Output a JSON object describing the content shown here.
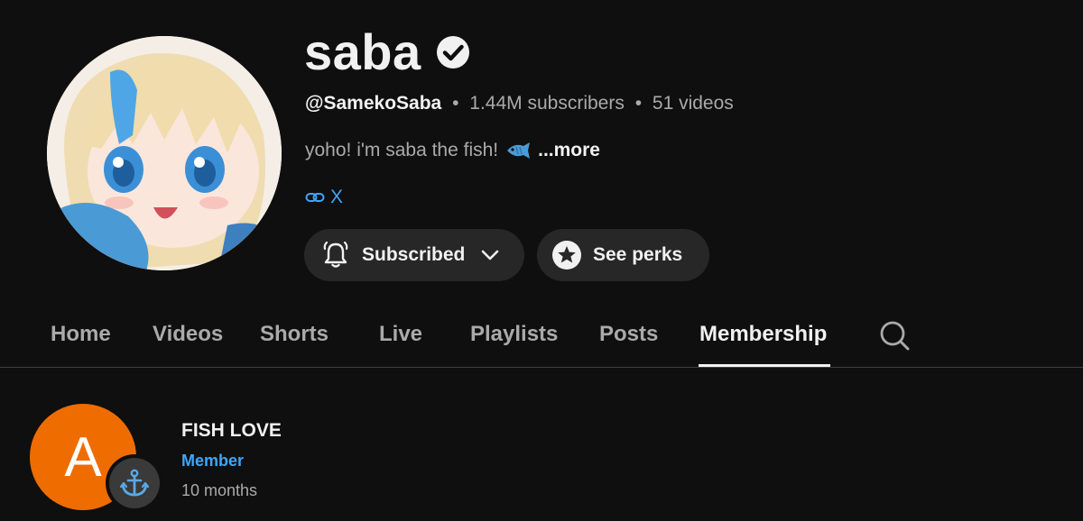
{
  "channel": {
    "name": "saba",
    "verified_icon": "verified-check-icon",
    "handle": "@SamekoSaba",
    "separator": "•",
    "subscribers": "1.44M subscribers",
    "videos": "51 videos",
    "description": "yoho! i'm saba the fish!",
    "description_emoji_icon": "fish-icon",
    "more_label": "...more",
    "link_label": "X",
    "link_icon": "link-icon"
  },
  "actions": {
    "subscribed_label": "Subscribed",
    "see_perks_label": "See perks"
  },
  "tabs": [
    {
      "label": "Home"
    },
    {
      "label": "Videos"
    },
    {
      "label": "Shorts"
    },
    {
      "label": "Live"
    },
    {
      "label": "Playlists"
    },
    {
      "label": "Posts"
    },
    {
      "label": "Membership",
      "active": true
    }
  ],
  "member": {
    "avatar_letter": "A",
    "avatar_color": "#ef6c00",
    "badge_icon": "anchor-icon",
    "name": "FISH LOVE",
    "level": "Member",
    "duration": "10 months"
  },
  "colors": {
    "background": "#0f0f0f",
    "text_primary": "#f1f1f1",
    "text_secondary": "#aaaaaa",
    "accent_link": "#3ea6ff",
    "button_bg": "#272727"
  }
}
